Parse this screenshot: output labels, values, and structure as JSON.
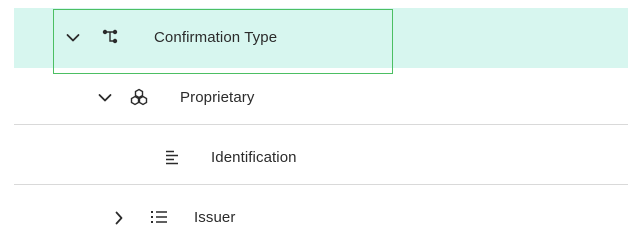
{
  "tree": {
    "items": [
      {
        "label": "Confirmation Type",
        "expanded": true,
        "selected": true,
        "icon": "hierarchy-icon"
      },
      {
        "label": "Proprietary",
        "expanded": true,
        "icon": "modules-icon"
      },
      {
        "label": "Identification",
        "icon": "text-align-left-icon"
      },
      {
        "label": "Issuer",
        "expanded": false,
        "icon": "list-icon"
      }
    ]
  },
  "colors": {
    "selected_row_bg": "#d7f6ef",
    "selection_border": "#4cbf63",
    "divider": "#d9d9d9",
    "text": "#2b2b2b"
  }
}
